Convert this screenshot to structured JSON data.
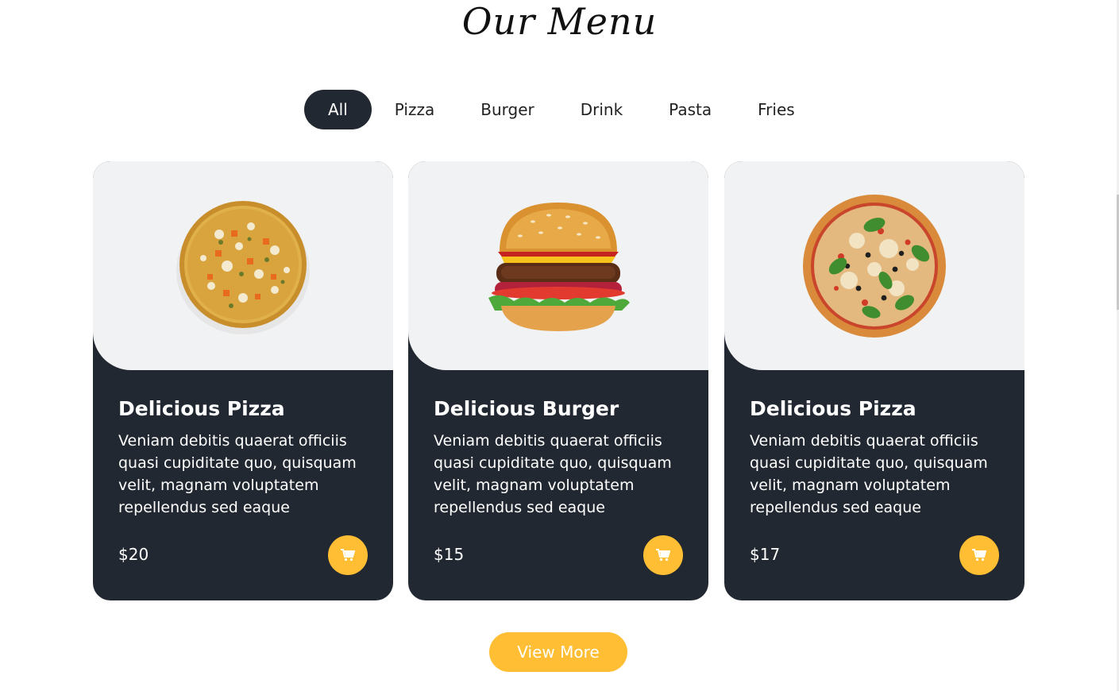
{
  "heading": "Our Menu",
  "filters": [
    {
      "label": "All",
      "active": true
    },
    {
      "label": "Pizza"
    },
    {
      "label": "Burger"
    },
    {
      "label": "Drink"
    },
    {
      "label": "Pasta"
    },
    {
      "label": "Fries"
    }
  ],
  "cards": [
    {
      "title": "Delicious Pizza",
      "description": "Veniam debitis quaerat officiis quasi cupiditate quo, quisquam velit, magnam voluptatem repellendus sed eaque",
      "price": "$20",
      "image": "veggie-pizza-image",
      "cart_icon": "cart-icon"
    },
    {
      "title": "Delicious Burger",
      "description": "Veniam debitis quaerat officiis quasi cupiditate quo, quisquam velit, magnam voluptatem repellendus sed eaque",
      "price": "$15",
      "image": "burger-image",
      "cart_icon": "cart-icon"
    },
    {
      "title": "Delicious Pizza",
      "description": "Veniam debitis quaerat officiis quasi cupiditate quo, quisquam velit, magnam voluptatem repellendus sed eaque",
      "price": "$17",
      "image": "basil-pizza-image",
      "cart_icon": "cart-icon"
    }
  ],
  "view_more_label": "View More",
  "colors": {
    "dark": "#222831",
    "accent": "#ffbe33",
    "light_panel": "#f1f2f3"
  }
}
